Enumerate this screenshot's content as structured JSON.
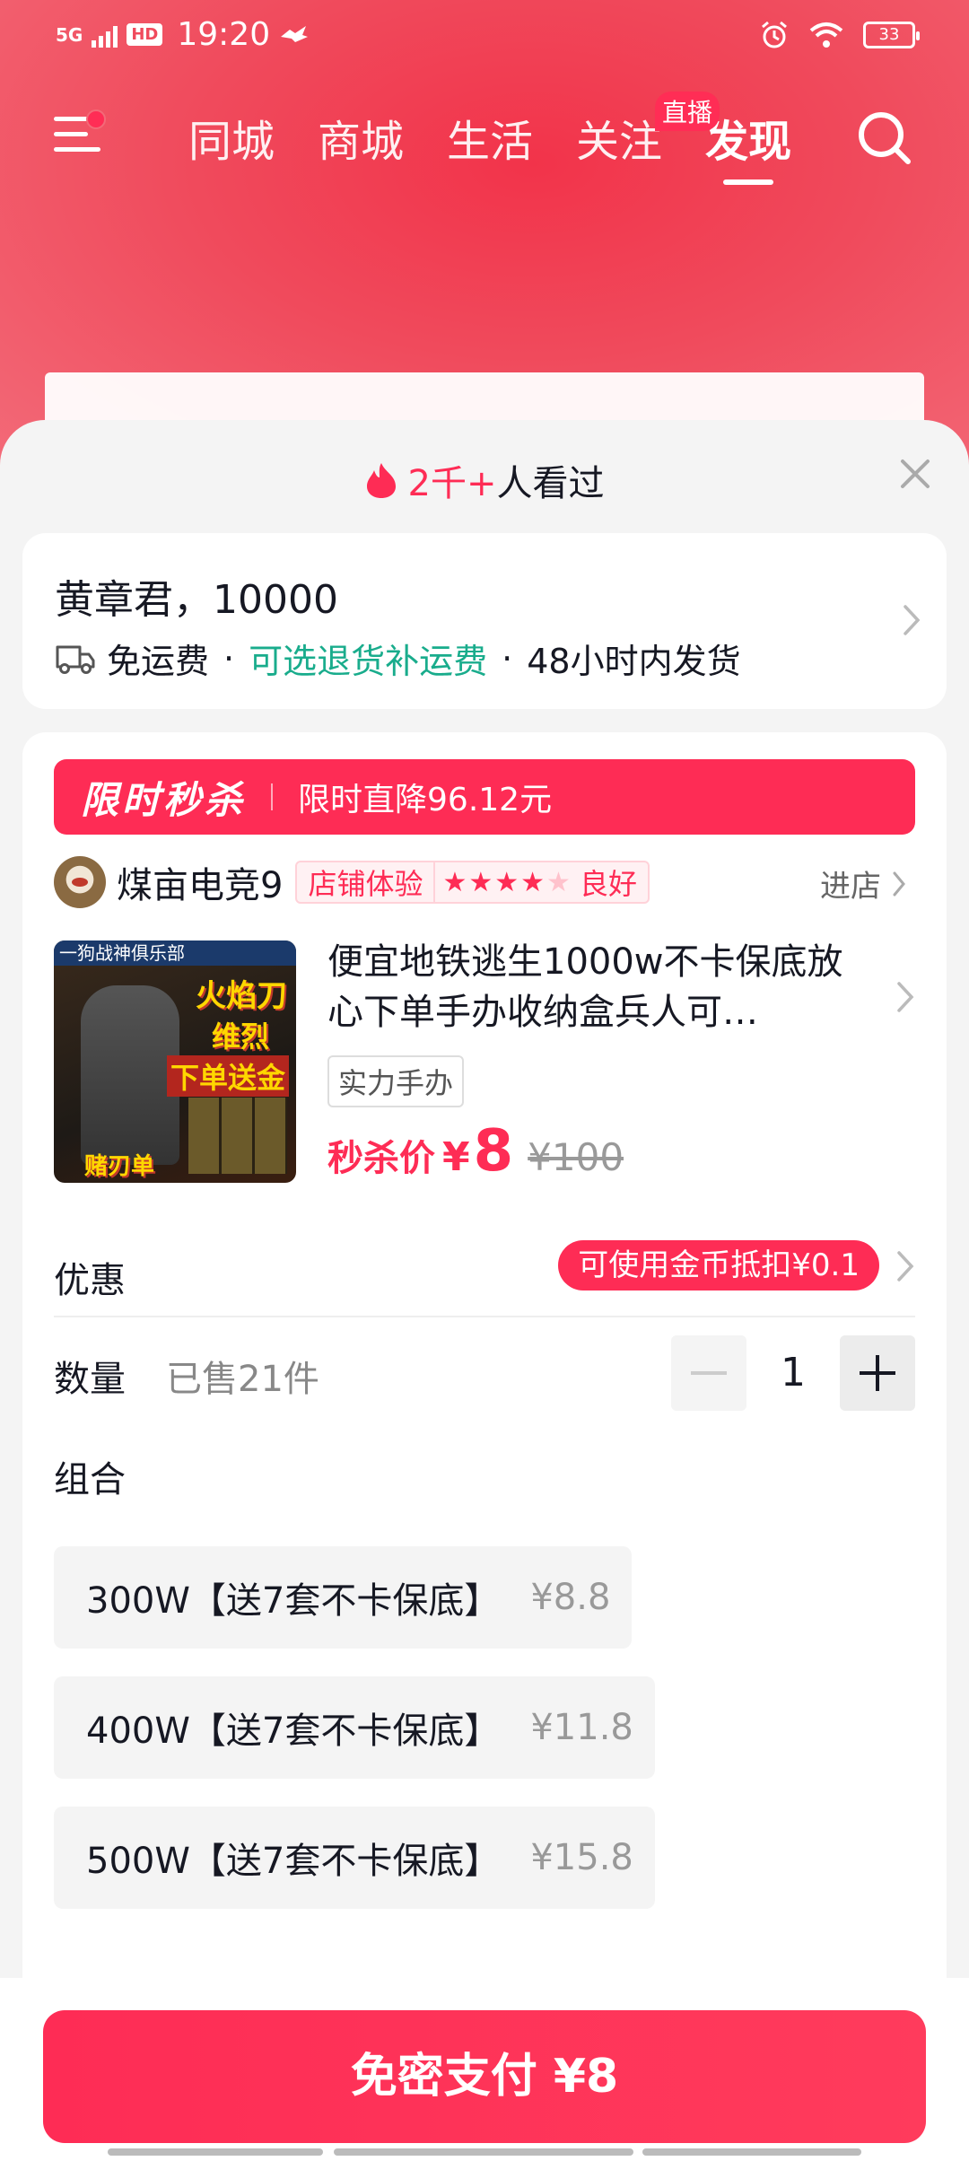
{
  "status_bar": {
    "network": "5G",
    "hd": "HD",
    "time": "19:20",
    "battery": "33"
  },
  "topnav": {
    "tabs": [
      {
        "label": "同城"
      },
      {
        "label": "商城"
      },
      {
        "label": "生活"
      },
      {
        "label": "关注"
      },
      {
        "label": "发现"
      }
    ],
    "active_tab": "发现",
    "live_badge": "直播"
  },
  "sheet": {
    "views_count": "2千+",
    "views_suffix": "人看过"
  },
  "address": {
    "recipient": "黄章君，10000",
    "shipping_free": "免运费",
    "return_shipping": "可选退货补运费",
    "dispatch": "48小时内发货",
    "separator": "·"
  },
  "flash_sale": {
    "title": "限时秒杀",
    "subtitle": "限时直降96.12元"
  },
  "shop": {
    "name": "煤亩电竞9",
    "badge_label": "店铺体验",
    "stars_filled": "★★★★",
    "stars_empty": "★",
    "rating": 4,
    "rating_text": "良好",
    "enter_label": "进店"
  },
  "product": {
    "image_band": "一狗战神俱乐部",
    "image_text_1": "火焰刀",
    "image_text_2": "维烈",
    "image_text_3": "下单送金",
    "image_text_4": "赌刃单",
    "title": "便宜地铁逃生1000w不卡保底放心下单手办收纳盒兵人可…",
    "tag": "实力手办",
    "price_label": "秒杀价",
    "currency": "¥",
    "price": "8",
    "original_price": "¥100"
  },
  "discount": {
    "label": "优惠",
    "pill": "可使用金币抵扣¥0.1"
  },
  "quantity": {
    "label": "数量",
    "sold": "已售21件",
    "value": "1"
  },
  "combos": {
    "label": "组合",
    "items": [
      {
        "name": "300W【送7套不卡保底】",
        "price": "¥8.8"
      },
      {
        "name": "400W【送7套不卡保底】",
        "price": "¥11.8"
      },
      {
        "name": "500W【送7套不卡保底】",
        "price": "¥15.8"
      }
    ]
  },
  "pay": {
    "label": "免密支付 ¥8"
  },
  "colors": {
    "accent": "#fe2c55",
    "green": "#19ac8c",
    "header_bg": "#f2334a"
  }
}
